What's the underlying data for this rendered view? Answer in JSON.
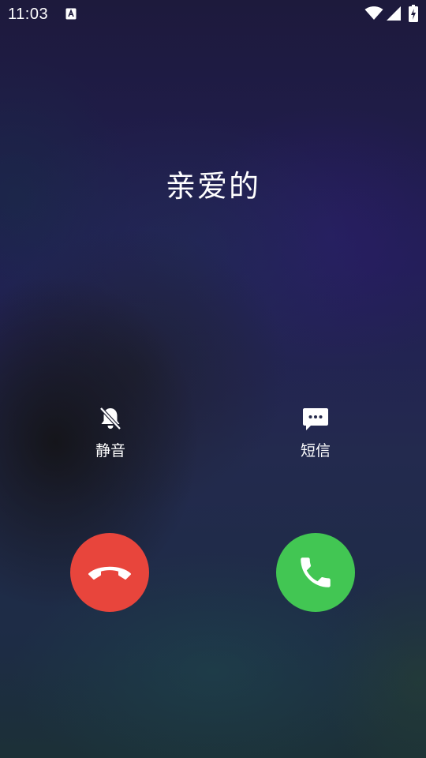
{
  "status_bar": {
    "time": "11:03",
    "notification_icon": "a-letter-icon",
    "wifi_icon": "wifi-icon",
    "signal_icon": "cell-signal-icon",
    "battery_icon": "battery-charging-icon"
  },
  "caller": {
    "name": "亲爱的"
  },
  "actions": {
    "mute": {
      "label": "静音",
      "icon": "bell-off-icon"
    },
    "sms": {
      "label": "短信",
      "icon": "message-icon"
    }
  },
  "buttons": {
    "decline": {
      "icon": "phone-hangup-icon",
      "color": "#e8453c"
    },
    "answer": {
      "icon": "phone-icon",
      "color": "#42c653"
    }
  }
}
